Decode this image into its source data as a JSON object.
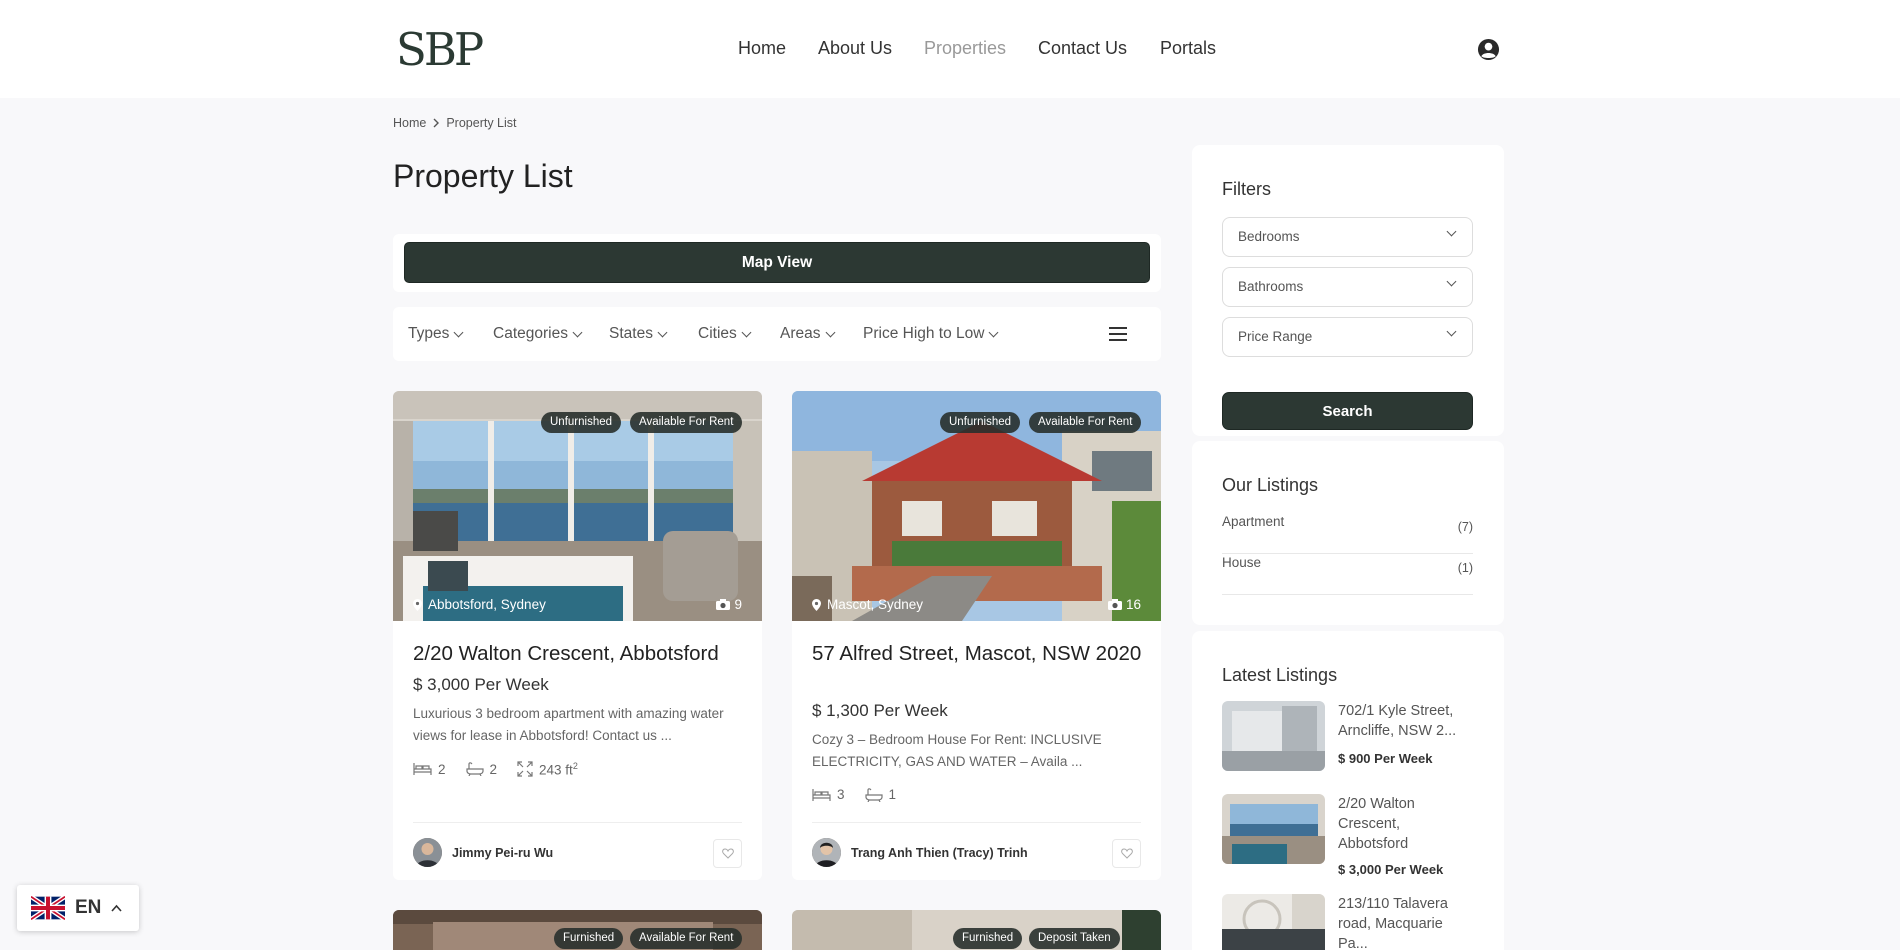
{
  "header": {
    "logo": "SBP",
    "nav": [
      "Home",
      "About Us",
      "Properties",
      "Contact Us",
      "Portals"
    ],
    "active_nav": "Properties"
  },
  "breadcrumb": {
    "home": "Home",
    "current": "Property List"
  },
  "page_title": "Property List",
  "map_view_label": "Map View",
  "filters_bar": [
    "Types",
    "Categories",
    "States",
    "Cities",
    "Areas",
    "Price High to Low"
  ],
  "cards": [
    {
      "badges": [
        "Unfurnished",
        "Available For Rent"
      ],
      "location": "Abbotsford, Sydney",
      "photo_count": "9",
      "title": "2/20 Walton Crescent, Abbotsford",
      "price": "$ 3,000 Per Week",
      "desc": "Luxurious 3 bedroom apartment with amazing water views for lease in Abbotsford! Contact us ...",
      "beds": "2",
      "baths": "2",
      "area": "243 ft",
      "area_sup": "2",
      "agent": "Jimmy Pei-ru Wu"
    },
    {
      "badges": [
        "Unfurnished",
        "Available For Rent"
      ],
      "location": "Mascot, Sydney",
      "photo_count": "16",
      "title": "57 Alfred Street, Mascot, NSW 2020",
      "price": "$ 1,300 Per Week",
      "desc": "Cozy 3 – Bedroom House For Rent: INCLUSIVE ELECTRICITY, GAS AND WATER – Availa ...",
      "beds": "3",
      "baths": "1",
      "agent": "Trang Anh Thien (Tracy) Trinh"
    }
  ],
  "row2_badges": [
    [
      "Furnished",
      "Available For Rent"
    ],
    [
      "Furnished",
      "Deposit Taken"
    ]
  ],
  "sidebar": {
    "filters_title": "Filters",
    "bedrooms": "Bedrooms",
    "bathrooms": "Bathrooms",
    "price_range": "Price Range",
    "search": "Search",
    "listings_title": "Our Listings",
    "listings": [
      {
        "label": "Apartment",
        "count": "(7)"
      },
      {
        "label": "House",
        "count": "(1)"
      }
    ],
    "latest_title": "Latest Listings",
    "latest": [
      {
        "title": "702/1 Kyle Street, Arncliffe, NSW 2...",
        "price": "$ 900 Per Week"
      },
      {
        "title": "2/20 Walton Crescent, Abbotsford",
        "price": "$ 3,000 Per Week"
      },
      {
        "title": "213/110 Talavera road, Macquarie Pa...",
        "price": ""
      }
    ]
  },
  "language": "EN",
  "colors": {
    "primary": "#2c3833",
    "badge": "#28302c"
  }
}
